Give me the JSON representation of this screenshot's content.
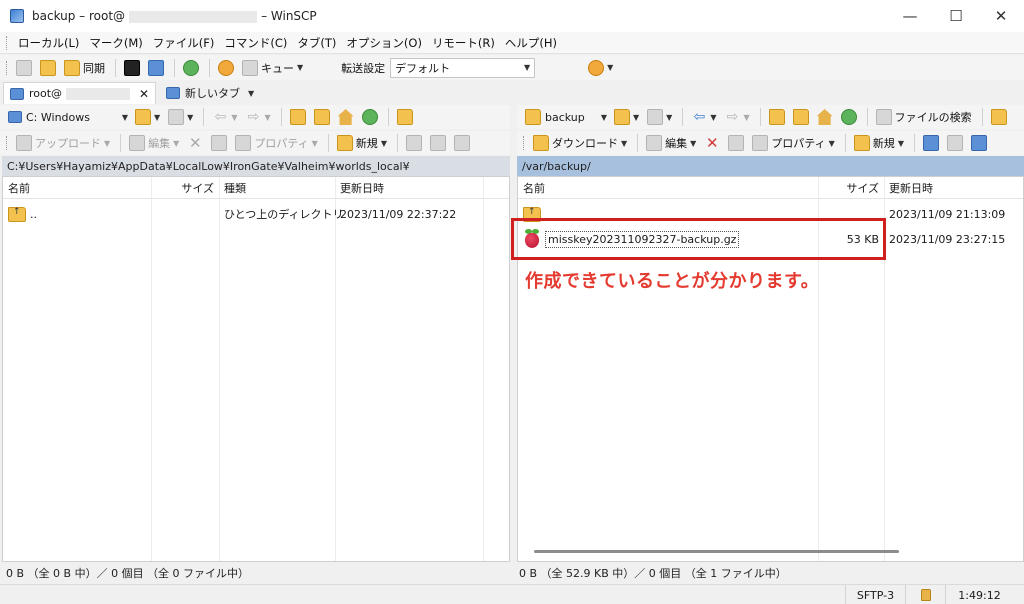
{
  "window": {
    "title_prefix": "backup – root@",
    "title_suffix": "– WinSCP",
    "minimize": "—",
    "maximize": "☐",
    "close": "✕"
  },
  "menu": [
    "ローカル(L)",
    "マーク(M)",
    "ファイル(F)",
    "コマンド(C)",
    "タブ(T)",
    "オプション(O)",
    "リモート(R)",
    "ヘルプ(H)"
  ],
  "toolbar": {
    "sync_label": "同期",
    "queue_label": "キュー",
    "transfer_label": "転送設定",
    "transfer_value": "デフォルト"
  },
  "tabs": {
    "session_label": "root@",
    "new_tab_label": "新しいタブ"
  },
  "left": {
    "drive": "C: Windows",
    "upload_label": "アップロード",
    "edit_label": "編集",
    "properties_label": "プロパティ",
    "new_label": "新規",
    "path": "C:¥Users¥Hayamiz¥AppData¥LocalLow¥IronGate¥Valheim¥worlds_local¥",
    "columns": [
      "名前",
      "サイズ",
      "種類",
      "更新日時"
    ],
    "rows": [
      {
        "name": "..",
        "size": "",
        "type": "ひとつ上のディレクトリ",
        "modified": "2023/11/09 22:37:22"
      }
    ],
    "status": "0 B （全 0 B 中）／ 0 個目 （全 0 ファイル中）"
  },
  "right": {
    "dir": "backup",
    "download_label": "ダウンロード",
    "edit_label": "編集",
    "properties_label": "プロパティ",
    "new_label": "新規",
    "find_label": "ファイルの検索",
    "path": "/var/backup/",
    "columns": [
      "名前",
      "サイズ",
      "更新日時"
    ],
    "rows": [
      {
        "name": "",
        "size": "",
        "modified": "2023/11/09 21:13:09"
      },
      {
        "name": "misskey202311092327-backup.gz",
        "size": "53 KB",
        "modified": "2023/11/09 23:27:15"
      }
    ],
    "status": "0 B （全 52.9 KB 中）／ 0 個目 （全 1 ファイル中）"
  },
  "annotation": {
    "text": "作成できていることが分かります。",
    "color": "#e53a2f",
    "box_color": "#d01f1f"
  },
  "statusbar": {
    "protocol": "SFTP-3",
    "time": "1:49:12"
  }
}
